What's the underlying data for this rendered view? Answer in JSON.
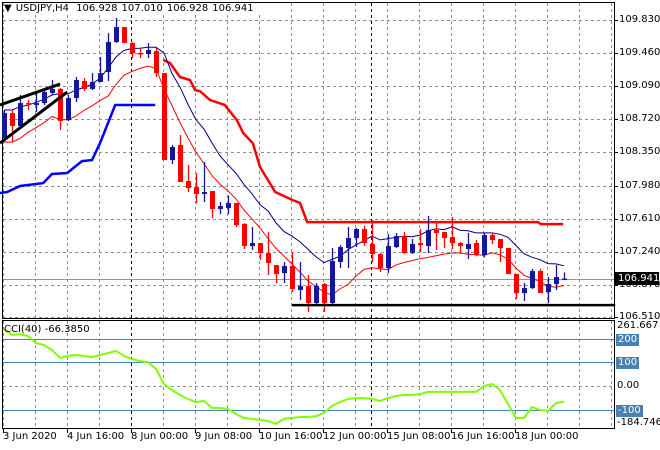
{
  "header": {
    "symbol_timeframe": "USDJPY,H4",
    "open": "106.928",
    "high": "107.010",
    "low": "106.928",
    "close": "106.941"
  },
  "chart_data": {
    "type": "candlestick",
    "title": "USDJPY,H4",
    "price_ticks": [
      "109.830",
      "109.460",
      "109.090",
      "108.720",
      "108.350",
      "107.980",
      "107.610",
      "107.240",
      "106.870",
      "106.510"
    ],
    "current_price": "106.941",
    "time_labels": [
      {
        "label": "3 Jun 2020",
        "index": 0
      },
      {
        "label": "4 Jun 16:00",
        "index": 8
      },
      {
        "label": "8 Jun 00:00",
        "index": 16
      },
      {
        "label": "9 Jun 08:00",
        "index": 24
      },
      {
        "label": "10 Jun 16:00",
        "index": 32
      },
      {
        "label": "12 Jun 00:00",
        "index": 40
      },
      {
        "label": "15 Jun 08:00",
        "index": 48
      },
      {
        "label": "16 Jun 16:00",
        "index": 56
      },
      {
        "label": "18 Jun 00:00",
        "index": 64
      }
    ],
    "period_separators": [
      15.875,
      45.875
    ],
    "candles_ohlc": [
      [
        108.511,
        108.824,
        108.466,
        108.79
      ],
      [
        108.79,
        108.824,
        108.466,
        108.645
      ],
      [
        108.645,
        108.992,
        108.645,
        108.902
      ],
      [
        108.902,
        108.936,
        108.824,
        108.891
      ],
      [
        108.88,
        109.025,
        108.802,
        108.902
      ],
      [
        108.902,
        109.059,
        108.88,
        109.025
      ],
      [
        109.014,
        109.159,
        108.992,
        109.059
      ],
      [
        109.059,
        109.07,
        108.601,
        108.701
      ],
      [
        108.712,
        108.992,
        108.701,
        108.958
      ],
      [
        108.958,
        109.193,
        108.913,
        109.159
      ],
      [
        109.148,
        109.18,
        109.036,
        109.059
      ],
      [
        109.059,
        109.237,
        109.047,
        109.137
      ],
      [
        109.137,
        109.416,
        109.137,
        109.237
      ],
      [
        109.249,
        109.684,
        109.148,
        109.584
      ],
      [
        109.584,
        109.852,
        109.573,
        109.751
      ],
      [
        109.751,
        109.751,
        109.573,
        109.573
      ],
      [
        109.573,
        109.584,
        109.405,
        109.461
      ],
      [
        109.461,
        109.52,
        109.405,
        109.45
      ],
      [
        109.45,
        109.573,
        109.405,
        109.494
      ],
      [
        109.483,
        109.52,
        109.193,
        109.237
      ],
      [
        109.237,
        109.237,
        108.265,
        108.265
      ],
      [
        108.265,
        108.433,
        108.221,
        108.411
      ],
      [
        108.433,
        108.545,
        108.02,
        108.02
      ],
      [
        108.031,
        108.209,
        107.908,
        107.952
      ],
      [
        107.964,
        108.12,
        107.785,
        107.886
      ],
      [
        107.886,
        108.243,
        107.796,
        107.908
      ],
      [
        107.919,
        107.919,
        107.617,
        107.718
      ],
      [
        107.718,
        107.796,
        107.66,
        107.751
      ],
      [
        107.729,
        107.87,
        107.66,
        107.785
      ],
      [
        107.785,
        107.785,
        107.517,
        107.539
      ],
      [
        107.55,
        107.56,
        107.271,
        107.304
      ],
      [
        107.304,
        107.517,
        107.26,
        107.338
      ],
      [
        107.338,
        107.338,
        107.15,
        107.226
      ],
      [
        107.226,
        107.461,
        106.98,
        107.115
      ],
      [
        107.092,
        107.092,
        106.891,
        106.992
      ],
      [
        107.003,
        107.126,
        106.891,
        107.081
      ],
      [
        107.081,
        107.237,
        106.79,
        106.824
      ],
      [
        106.813,
        107.126,
        106.701,
        106.857
      ],
      [
        106.857,
        106.98,
        106.567,
        106.668
      ],
      [
        106.668,
        106.891,
        106.634,
        106.857
      ],
      [
        106.88,
        106.891,
        106.567,
        106.668
      ],
      [
        106.668,
        107.282,
        106.645,
        107.137
      ],
      [
        107.126,
        107.315,
        107.059,
        107.293
      ],
      [
        107.282,
        107.517,
        107.059,
        107.394
      ],
      [
        107.394,
        107.505,
        107.293,
        107.494
      ],
      [
        107.494,
        107.528,
        107.304,
        107.338
      ],
      [
        107.327,
        107.595,
        107.126,
        107.215
      ],
      [
        107.215,
        107.226,
        107.014,
        107.059
      ],
      [
        107.059,
        107.438,
        107.003,
        107.304
      ],
      [
        107.293,
        107.45,
        107.282,
        107.416
      ],
      [
        107.416,
        107.461,
        107.215,
        107.226
      ],
      [
        107.226,
        107.383,
        107.215,
        107.327
      ],
      [
        107.338,
        107.494,
        107.237,
        107.316
      ],
      [
        107.304,
        107.64,
        107.226,
        107.483
      ],
      [
        107.483,
        107.57,
        107.26,
        107.45
      ],
      [
        107.461,
        107.461,
        107.282,
        107.394
      ],
      [
        107.405,
        107.629,
        107.271,
        107.338
      ],
      [
        107.338,
        107.35,
        107.226,
        107.304
      ],
      [
        107.271,
        107.45,
        107.16,
        107.327
      ],
      [
        107.338,
        107.371,
        107.19,
        107.204
      ],
      [
        107.204,
        107.45,
        107.18,
        107.427
      ],
      [
        107.427,
        107.45,
        107.327,
        107.371
      ],
      [
        107.383,
        107.383,
        107.126,
        107.282
      ],
      [
        107.282,
        107.282,
        106.992,
        106.992
      ],
      [
        106.992,
        106.992,
        106.712,
        106.779
      ],
      [
        106.779,
        106.891,
        106.69,
        106.835
      ],
      [
        106.835,
        107.05,
        106.824,
        107.025
      ],
      [
        107.025,
        107.05,
        106.779,
        106.779
      ],
      [
        106.79,
        106.958,
        106.668,
        106.88
      ],
      [
        106.88,
        107.092,
        106.813,
        106.958
      ],
      [
        106.928,
        107.01,
        106.928,
        106.941
      ]
    ],
    "overlays": {
      "upper_channel_red": [
        [
          19.9,
          109.383
        ],
        [
          20.75,
          109.349
        ],
        [
          22,
          109.193
        ],
        [
          23.25,
          109.159
        ],
        [
          23.9,
          109.047
        ],
        [
          24.5,
          109.036
        ],
        [
          25.75,
          108.936
        ],
        [
          27.6,
          108.88
        ],
        [
          29.1,
          108.712
        ],
        [
          29.9,
          108.567
        ],
        [
          31.1,
          108.455
        ],
        [
          32,
          108.187
        ],
        [
          33.9,
          107.908
        ],
        [
          36.1,
          107.818
        ],
        [
          37,
          107.785
        ],
        [
          37.9,
          107.572
        ],
        [
          66.75,
          107.572
        ],
        [
          67.1,
          107.55
        ],
        [
          69.9,
          107.55
        ]
      ],
      "lower_channel_blue": [
        [
          -0.5,
          107.897
        ],
        [
          0.4,
          107.908
        ],
        [
          2,
          107.975
        ],
        [
          4.9,
          108.008
        ],
        [
          6,
          108.109
        ],
        [
          7.9,
          108.12
        ],
        [
          9.75,
          108.254
        ],
        [
          11,
          108.265
        ],
        [
          12,
          108.455
        ],
        [
          13.9,
          108.88
        ],
        [
          18.9,
          108.88
        ]
      ],
      "trendline_upper": [
        [
          -0.5,
          108.88
        ],
        [
          7,
          109.114
        ]
      ],
      "trendline_lower": [
        [
          -0.5,
          108.455
        ],
        [
          7.9,
          109.025
        ]
      ],
      "support_line": [
        [
          36,
          106.645
        ],
        [
          76.4,
          106.645
        ]
      ],
      "ma_period": 8
    },
    "cci": {
      "label": "CCI(40)",
      "value": "-66.3850",
      "scale_max": "261.667",
      "scale_min": "-184.746",
      "levels": [
        {
          "label": "200",
          "value": 200
        },
        {
          "label": "100",
          "value": 100
        },
        {
          "label": "-100",
          "value": -100
        }
      ],
      "zero_label": "0.00",
      "values": [
        240,
        215,
        219,
        211,
        181,
        173,
        152,
        118,
        127,
        131,
        127,
        122,
        131,
        139,
        148,
        127,
        114,
        105,
        101,
        72,
        8,
        -17,
        -38,
        -55,
        -68,
        -63,
        -93,
        -93,
        -97,
        -118,
        -135,
        -139,
        -143,
        -148,
        -160,
        -139,
        -135,
        -131,
        -131,
        -127,
        -114,
        -84,
        -68,
        -55,
        -51,
        -51,
        -55,
        -63,
        -51,
        -42,
        -38,
        -38,
        -34,
        -25,
        -25,
        -25,
        -25,
        -25,
        -25,
        -25,
        0,
        8,
        -17,
        -76,
        -135,
        -135,
        -89,
        -101,
        -105,
        -72,
        -66.385
      ]
    }
  },
  "colors": {
    "bull": "#1018a0",
    "bear": "#ff0000",
    "ma_high": "#000080",
    "ma_low": "#ff0000",
    "upper_channel": "#ff0000",
    "lower_channel": "#0000ff",
    "trendline": "#000000",
    "cci_line": "#7fff00",
    "cci_level": "#4682b4",
    "grid": "#8a8f99"
  }
}
